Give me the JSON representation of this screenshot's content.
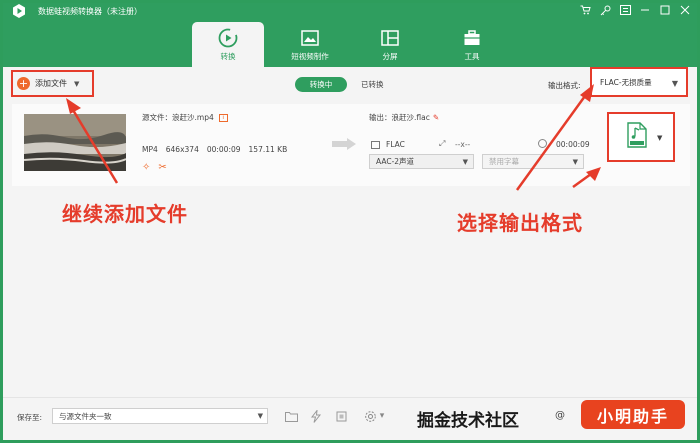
{
  "titlebar": {
    "app_title": "数据蛙视频转换器（未注册）",
    "controls": [
      "cart-icon",
      "key-icon",
      "menu-icon",
      "minimize-icon",
      "maximize-icon",
      "close-icon"
    ]
  },
  "nav": {
    "tabs": [
      {
        "label": "转换",
        "icon": "convert-icon",
        "active": true
      },
      {
        "label": "短视频制作",
        "icon": "short-video-icon",
        "active": false
      },
      {
        "label": "分屏",
        "icon": "split-screen-icon",
        "active": false
      },
      {
        "label": "工具",
        "icon": "toolbox-icon",
        "active": false
      }
    ]
  },
  "toolbar": {
    "add_file_label": "添加文件",
    "converting_tab": "转换中",
    "converted_tab": "已转换",
    "output_format_label": "输出格式:",
    "output_format_value": "FLAC-无损质量"
  },
  "file": {
    "source_label": "源文件：浪赶沙.mp4",
    "format": "MP4",
    "resolution": "646x374",
    "duration": "00:00:09",
    "size": "157.11 KB",
    "output_label": "输出：浪赶沙.flac",
    "out_format": "FLAC",
    "out_resolution": "--x--",
    "out_duration": "00:00:09",
    "audio_channel": "AAC-2声道",
    "subtitle": "禁用字幕"
  },
  "annotations": {
    "left_text": "继续添加文件",
    "right_text": "选择输出格式"
  },
  "bottom": {
    "save_to_label": "保存至:",
    "save_to_value": "与源文件夹一致",
    "watermark": "掘金技术社区",
    "watermark_at": "@",
    "badge": "小明助手"
  },
  "colors": {
    "brand_green": "#2f9e5f",
    "accent_orange": "#ee6a2c",
    "annotation_red": "#e53c2b"
  }
}
